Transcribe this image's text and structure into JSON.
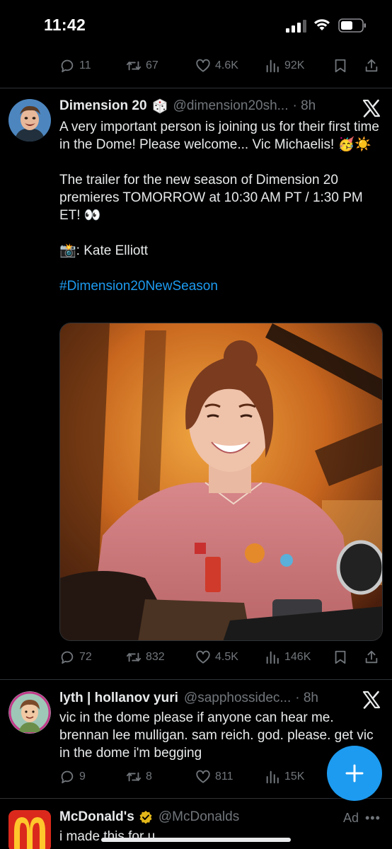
{
  "status_bar": {
    "time": "11:42"
  },
  "prev_tweet": {
    "stats": {
      "replies": "11",
      "reposts": "67",
      "likes": "4.6K",
      "views": "92K"
    }
  },
  "tweet1": {
    "name": "Dimension 20",
    "name_emoji": "die",
    "handle": "@dimension20sh...",
    "time": "· 8h",
    "text_line1": "A very important person is joining us for their first time in the Dome! Please welcome... Vic Michaelis! 🥳☀️",
    "text_line2": "The trailer for the new season of Dimension 20 premieres TOMORROW at 10:30 AM PT / 1:30 PM ET! 👀",
    "text_line3": "📸: Kate Elliott",
    "hashtag": "#Dimension20NewSeason",
    "stats": {
      "replies": "72",
      "reposts": "832",
      "likes": "4.5K",
      "views": "146K"
    }
  },
  "tweet2": {
    "name": "lyth | hollanov yuri",
    "handle": "@sapphossidec...",
    "time": "· 8h",
    "text": "vic in the dome please if anyone can hear me. brennan lee mulligan. sam reich. god. please. get vic in the dome i'm begging",
    "stats": {
      "replies": "9",
      "reposts": "8",
      "likes": "811",
      "views": "15K"
    }
  },
  "tweet3": {
    "name": "McDonald's",
    "handle": "@McDonalds",
    "ad_label": "Ad",
    "more": "•••",
    "text": "i made this for u"
  },
  "colors": {
    "accent": "#1d9bf0",
    "muted": "#71767b",
    "text": "#e7e9ea",
    "background": "#000000",
    "mcd_red": "#da291c",
    "mcd_yellow": "#ffc72c"
  },
  "icons": [
    "reply-icon",
    "repost-icon",
    "like-icon",
    "views-icon",
    "bookmark-icon",
    "share-icon",
    "x-logo-icon",
    "compose-icon"
  ]
}
